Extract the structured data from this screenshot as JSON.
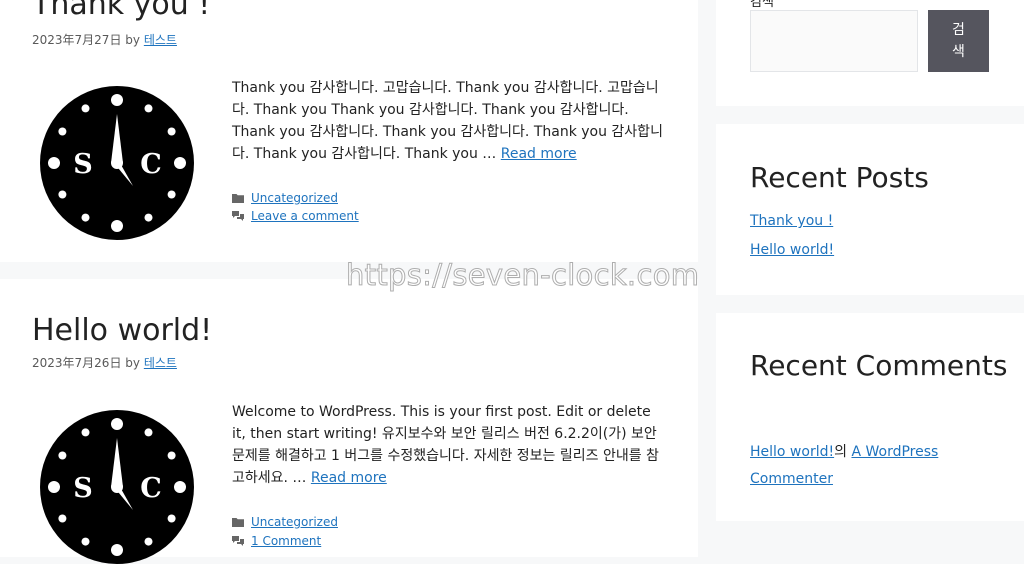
{
  "posts": [
    {
      "title": "Thank you !",
      "date": "2023年7月27日",
      "by": "by",
      "author": "테스트",
      "excerpt": "Thank you 감사합니다. 고맙습니다. Thank you 감사합니다. 고맙습니다. Thank you Thank you 감사합니다. Thank you 감사합니다. Thank you 감사합니다. Thank you 감사합니다. Thank you 감사합니다. Thank you 감사합니다. Thank you …",
      "read_more": "Read more",
      "category": "Uncategorized",
      "comments": "Leave a comment"
    },
    {
      "title": "Hello world!",
      "date": "2023年7月26日",
      "by": "by",
      "author": "테스트",
      "excerpt": "Welcome to WordPress. This is your first post. Edit or delete it, then start writing! 유지보수와 보안 릴리스 버전 6.2.2이(가) 보안 문제를 해결하고 1 버그를 수정했습니다. 자세한 정보는 릴리즈 안내를 참고하세요. …",
      "read_more": "Read more",
      "category": "Uncategorized",
      "comments": "1 Comment"
    }
  ],
  "logo": {
    "left_letter": "S",
    "right_letter": "C"
  },
  "sidebar": {
    "search": {
      "label": "검색",
      "button": "검\n색"
    },
    "recent_posts": {
      "title": "Recent Posts",
      "items": [
        "Thank you !",
        "Hello world!"
      ]
    },
    "recent_comments": {
      "title": "Recent Comments",
      "post_link": "Hello world!",
      "connector": "의",
      "author": "A WordPress Commenter"
    }
  },
  "watermark": "https://seven-clock.com",
  "colors": {
    "link": "#1e73be",
    "background": "#f7f8f9",
    "button": "#55555e"
  }
}
